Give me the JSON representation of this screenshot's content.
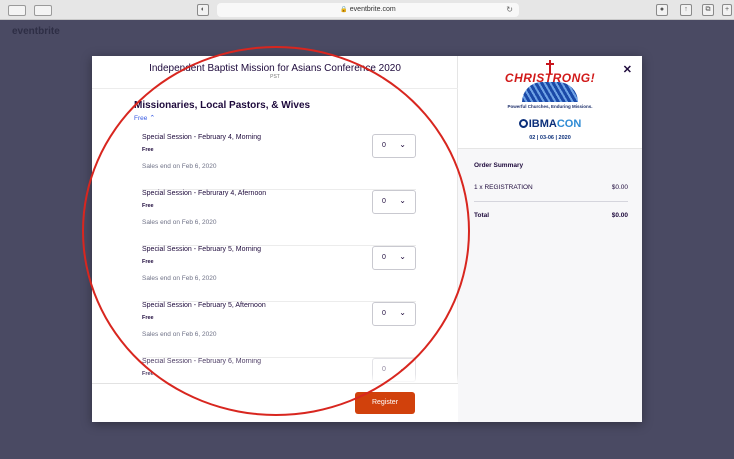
{
  "browser": {
    "url": "eventbrite.com"
  },
  "site": {
    "logo_text": "eventbrite"
  },
  "event": {
    "title": "Independent Baptist Mission for Asians Conference 2020",
    "timezone": "PST"
  },
  "tier": {
    "title": "Missionaries, Local Pastors, & Wives",
    "price_toggle": "Free"
  },
  "tickets": [
    {
      "name": "Special Session - February 4, Morning",
      "price": "Free",
      "sales_end": "Sales end on Feb 6, 2020",
      "quantity": "0"
    },
    {
      "name": "Special Session - Februrary 4, Afernoon",
      "price": "Free",
      "sales_end": "Sales end on Feb 6, 2020",
      "quantity": "0"
    },
    {
      "name": "Special Session - February 5, Morning",
      "price": "Free",
      "sales_end": "Sales end on Feb 6, 2020",
      "quantity": "0"
    },
    {
      "name": "Special Session - February 5, Afternoon",
      "price": "Free",
      "sales_end": "Sales end on Feb 6, 2020",
      "quantity": "0"
    },
    {
      "name": "Special Session - February 6, Morning",
      "price": "Free",
      "sales_end": "",
      "quantity": "0"
    }
  ],
  "footer": {
    "register_label": "Register"
  },
  "logo": {
    "word": "CHRISTRONG!",
    "tagline": "Powerful Churches, Enduring Missions.",
    "ibma_prefix": "IBMA",
    "ibma_suffix": "CON",
    "dates": "02 | 03-06 | 2020"
  },
  "order_summary": {
    "title": "Order Summary",
    "item_label": "1 x REGISTRATION",
    "item_price": "$0.00",
    "total_label": "Total",
    "total_price": "$0.00"
  },
  "colors": {
    "register_button": "#d1410c",
    "link_blue": "#3659e3",
    "annotation_red": "#d8261f",
    "backdrop": "#4a4a63"
  },
  "icons": {
    "close": "close-icon",
    "dropdown": "chevron-down-icon",
    "toggle": "chevron-up-icon"
  }
}
